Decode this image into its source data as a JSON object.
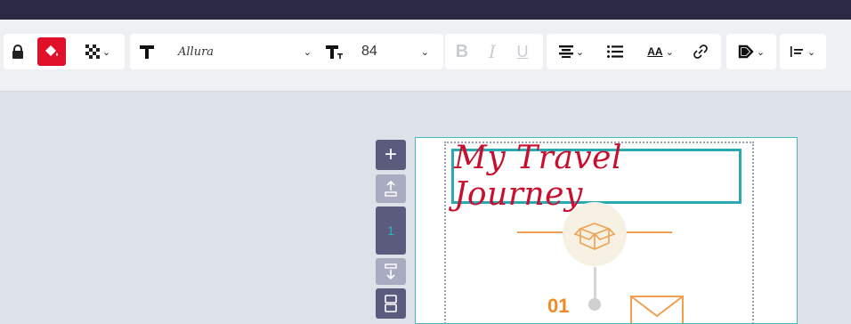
{
  "toolbar": {
    "font_name": "Allura",
    "font_size": "84",
    "bold": "B",
    "italic": "I",
    "underline": "U",
    "text_case": "AA"
  },
  "side_controls": {
    "page_number": "1"
  },
  "canvas": {
    "title": "My Travel Journey",
    "step_number": "01"
  },
  "colors": {
    "topbar": "#2a2a45",
    "fill_active": "#e0102a",
    "title": "#c8102e",
    "frame_accent": "#2aa8b4",
    "orange_accent": "#f08a24",
    "side_button": "#5a5b7d"
  }
}
